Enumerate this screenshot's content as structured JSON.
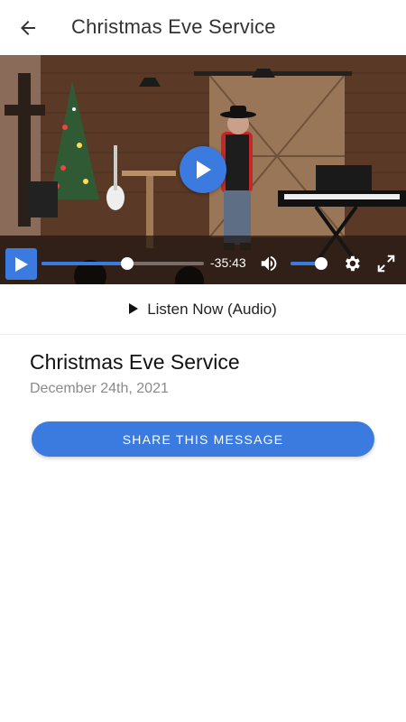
{
  "header": {
    "back_icon": "arrow-left-icon",
    "title": "Christmas Eve Service"
  },
  "video": {
    "big_play_icon": "play-icon",
    "controls": {
      "play_icon": "play-icon",
      "progress_fraction": 0.53,
      "time_remaining": "-35:43",
      "volume_icon": "volume-icon",
      "volume_fraction": 0.95,
      "settings_icon": "gear-icon",
      "fullscreen_icon": "fullscreen-icon"
    },
    "accent_color": "#3b7be0"
  },
  "listen": {
    "icon": "play-icon",
    "label": "Listen Now (Audio)"
  },
  "message": {
    "title": "Christmas Eve Service",
    "date": "December 24th, 2021",
    "share_label": "SHARE THIS MESSAGE"
  }
}
